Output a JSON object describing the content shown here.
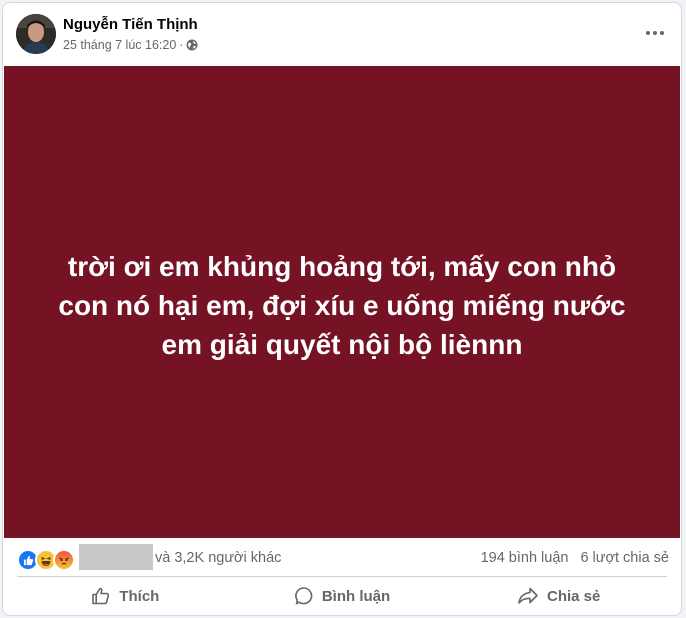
{
  "post": {
    "author": "Nguyễn Tiến Thịnh",
    "timestamp": "25 tháng 7 lúc 16:20",
    "separator": "·",
    "privacy_icon": "globe-icon",
    "more_icon": "more-horizontal-icon",
    "background_color": "#751224",
    "text_lines": [
      "trời ơi em khủng hoảng tới, mấy con nhỏ",
      "con nó hại em, đợi xíu e uống miếng nước",
      "em giải quyết nội bộ liènnn"
    ]
  },
  "stats": {
    "reactions": [
      "like-icon",
      "haha-icon",
      "angry-icon"
    ],
    "others_text": "và 3,2K người khác",
    "comments": "194 bình luận",
    "shares": "6 lượt chia sẻ"
  },
  "actions": {
    "like_label": "Thích",
    "comment_label": "Bình luận",
    "share_label": "Chia sẻ"
  },
  "colors": {
    "like_blue": "#1877f2",
    "angry_orange": "#f0533a",
    "haha_yellow": "#f7c23a",
    "muted_text": "#65676b"
  }
}
